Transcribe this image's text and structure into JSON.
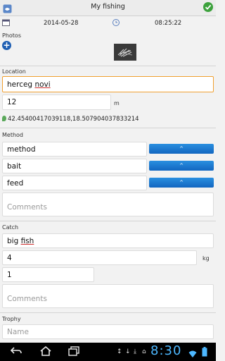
{
  "app": {
    "title": "My fishing"
  },
  "datetime": {
    "date": "2014-05-28",
    "time": "08:25:22"
  },
  "photos": {
    "label": "Photos"
  },
  "location": {
    "label": "Location",
    "name": {
      "before": "herceg ",
      "misspelled": "novi"
    },
    "distance": "12",
    "distance_unit": "m",
    "coordinates": "42.45400417039118,18.507904037833214"
  },
  "method": {
    "label": "Method",
    "fields": [
      {
        "value": "method",
        "spinner": "^"
      },
      {
        "value": "bait",
        "spinner": "^"
      },
      {
        "value": "feed",
        "spinner": "^"
      }
    ],
    "comments_placeholder": "Comments"
  },
  "catch": {
    "label": "Catch",
    "species": {
      "before": "big ",
      "misspelled": "fish"
    },
    "weight": "4",
    "weight_unit": "kg",
    "count": "1",
    "comments_placeholder": "Comments"
  },
  "trophy": {
    "label": "Trophy",
    "name_placeholder": "Name"
  },
  "statusbar": {
    "clock": "8:30"
  },
  "colors": {
    "accent": "#1a78d0",
    "focus": "#f0a030",
    "ok": "#3da23d",
    "clock": "#4db8ff"
  }
}
